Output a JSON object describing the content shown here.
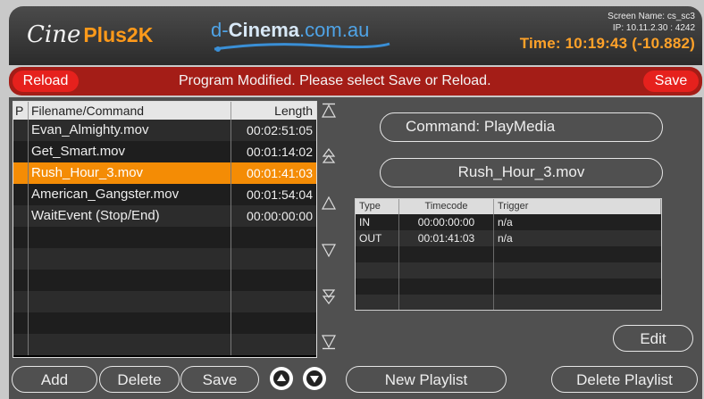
{
  "header": {
    "brand_cine": "Cine",
    "brand_plus": "Plus2K",
    "site_pre": "d-",
    "site_mid": "Cinema",
    "site_post": ".com.au",
    "screen_name": "Screen Name: cs_sc3",
    "ip": "IP: 10.11.2.30 : 4242",
    "time": "Time: 10:19:43 (-10.882)"
  },
  "status_bar": {
    "reload_label": "Reload",
    "message": "Program Modified. Please select Save or Reload.",
    "save_label": "Save"
  },
  "playlist": {
    "columns": [
      "P",
      "Filename/Command",
      "Length"
    ],
    "rows": [
      {
        "p": "",
        "name": "Evan_Almighty.mov",
        "length": "00:02:51:05"
      },
      {
        "p": "",
        "name": "Get_Smart.mov",
        "length": "00:01:14:02"
      },
      {
        "p": "",
        "name": "Rush_Hour_3.mov",
        "length": "00:01:41:03",
        "selected": true
      },
      {
        "p": "",
        "name": "American_Gangster.mov",
        "length": "00:01:54:04"
      },
      {
        "p": "",
        "name": "WaitEvent (Stop/End)",
        "length": "00:00:00:00"
      },
      {
        "p": "",
        "name": "",
        "length": ""
      },
      {
        "p": "",
        "name": "",
        "length": ""
      },
      {
        "p": "",
        "name": "",
        "length": ""
      },
      {
        "p": "",
        "name": "",
        "length": ""
      },
      {
        "p": "",
        "name": "",
        "length": ""
      },
      {
        "p": "",
        "name": "",
        "length": ""
      }
    ]
  },
  "side_nav": {
    "icons": [
      "move-to-top-icon",
      "page-up-icon",
      "up-icon",
      "down-icon",
      "page-down-icon",
      "move-to-bottom-icon"
    ]
  },
  "detail": {
    "command": "Command: PlayMedia",
    "media": "Rush_Hour_3.mov",
    "trigger_columns": [
      "Type",
      "Timecode",
      "Trigger"
    ],
    "triggers": [
      {
        "type": "IN",
        "timecode": "00:00:00:00",
        "trigger": "n/a"
      },
      {
        "type": "OUT",
        "timecode": "00:01:41:03",
        "trigger": "n/a"
      },
      {
        "type": "",
        "timecode": "",
        "trigger": ""
      },
      {
        "type": "",
        "timecode": "",
        "trigger": ""
      },
      {
        "type": "",
        "timecode": "",
        "trigger": ""
      },
      {
        "type": "",
        "timecode": "",
        "trigger": ""
      }
    ],
    "edit_label": "Edit"
  },
  "footer": {
    "add_label": "Add",
    "delete_label": "Delete",
    "save_label": "Save",
    "new_playlist_label": "New Playlist",
    "delete_playlist_label": "Delete Playlist"
  },
  "colors": {
    "accent_orange": "#f48c05",
    "status_red": "#a41d17",
    "button_red": "#e6211d",
    "panel_gray": "#505050"
  }
}
